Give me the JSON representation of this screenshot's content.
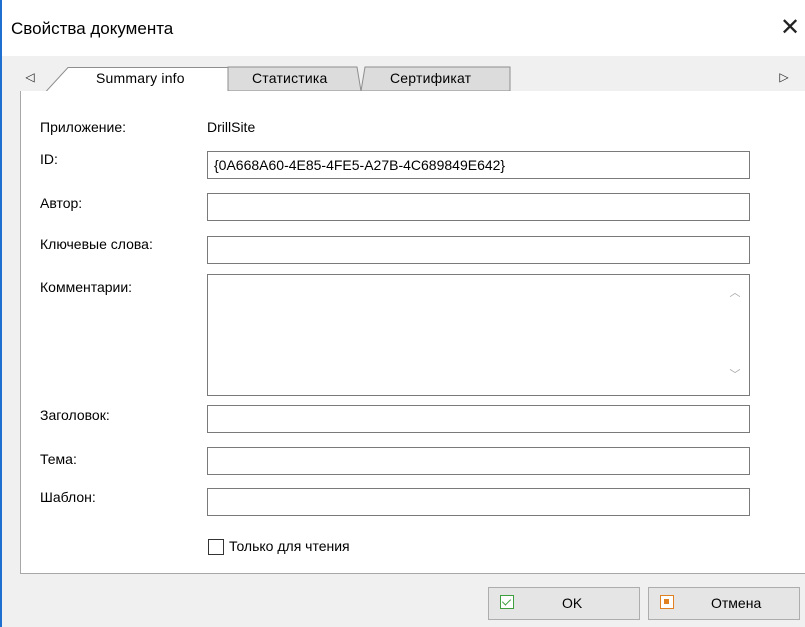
{
  "window": {
    "title": "Свойства документа",
    "close_icon": "close-icon",
    "accent_color": "#1e6fd0"
  },
  "tabs": [
    {
      "label": "Summary info",
      "active": true
    },
    {
      "label": "Статистика",
      "active": false
    },
    {
      "label": "Сертификат",
      "active": false
    }
  ],
  "form": {
    "app_label": "Приложение:",
    "app_value": "DrillSite",
    "id_label": "ID:",
    "id_value": "{0A668A60-4E85-4FE5-A27B-4C689849E642}",
    "author_label": "Автор:",
    "author_value": "",
    "keywords_label": "Ключевые слова:",
    "keywords_value": "",
    "comments_label": "Комментарии:",
    "comments_value": "",
    "title_label": "Заголовок:",
    "title_value": "",
    "subject_label": "Тема:",
    "subject_value": "",
    "template_label": "Шаблон:",
    "template_value": "",
    "readonly_label": "Только для чтения",
    "readonly_checked": false
  },
  "buttons": {
    "ok_label": "OK",
    "cancel_label": "Отмена",
    "ok_icon": "ok-check-icon",
    "cancel_icon": "cancel-icon"
  }
}
